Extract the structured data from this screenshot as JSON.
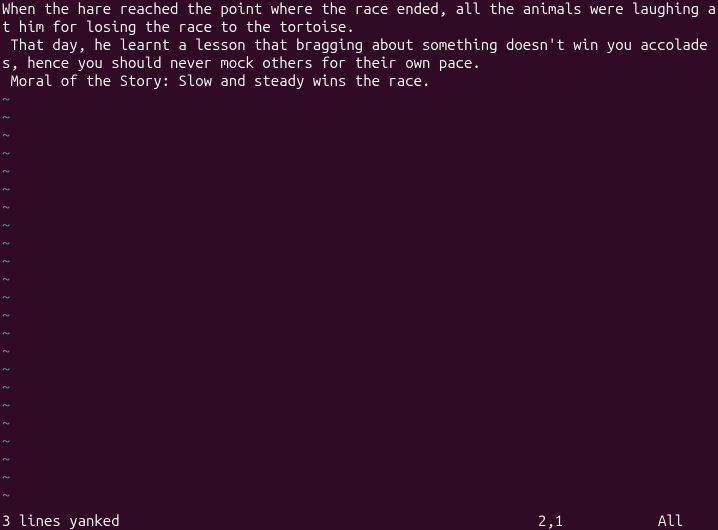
{
  "buffer": {
    "lines": [
      "When the hare reached the point where the race ended, all the animals were laughing at him for losing the race to the tortoise.",
      " That day, he learnt a lesson that bragging about something doesn't win you accolades, hence you should never mock others for their own pace.",
      " Moral of the Story: Slow and steady wins the race."
    ]
  },
  "tilde": "~",
  "tilde_count": 23,
  "status": {
    "message": "3 lines yanked",
    "cursor": "2,1",
    "scroll": "All"
  }
}
